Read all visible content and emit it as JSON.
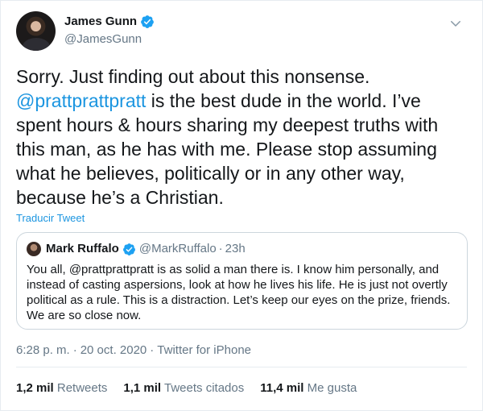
{
  "user": {
    "display_name": "James Gunn",
    "handle": "@JamesGunn"
  },
  "tweet": {
    "line1": "Sorry. Just finding out about this nonsense.",
    "mention": "@prattprattpratt",
    "body_rest": " is the best dude in the world. I’ve spent hours & hours sharing my deepest truths with this man, as he has with me. Please stop assuming what he believes, politically or in any other way, because he’s a Christian.",
    "translate_label": "Traducir Tweet"
  },
  "quote": {
    "display_name": "Mark Ruffalo",
    "handle": "@MarkRuffalo",
    "separator": "·",
    "time": "23h",
    "text": "You all, @prattprattpratt is as solid a man there is. I know him personally, and instead of casting aspersions, look at how he lives his life. He is just not overtly political as a rule. This is a distraction. Let’s keep our eyes on the prize, friends. We are so close now."
  },
  "meta": {
    "time": "6:28 p. m.",
    "separator": "·",
    "date": "20 oct. 2020",
    "source": "Twitter for iPhone"
  },
  "stats": {
    "retweets_num": "1,2 mil",
    "retweets_label": "Retweets",
    "quotes_num": "1,1 mil",
    "quotes_label": "Tweets citados",
    "likes_num": "11,4 mil",
    "likes_label": "Me gusta"
  },
  "colors": {
    "accent": "#1b95e0",
    "secondary_text": "#657786",
    "border": "#ccd6dd"
  },
  "icons": {
    "verified": "verified-badge-icon",
    "menu": "chevron-down-icon"
  }
}
